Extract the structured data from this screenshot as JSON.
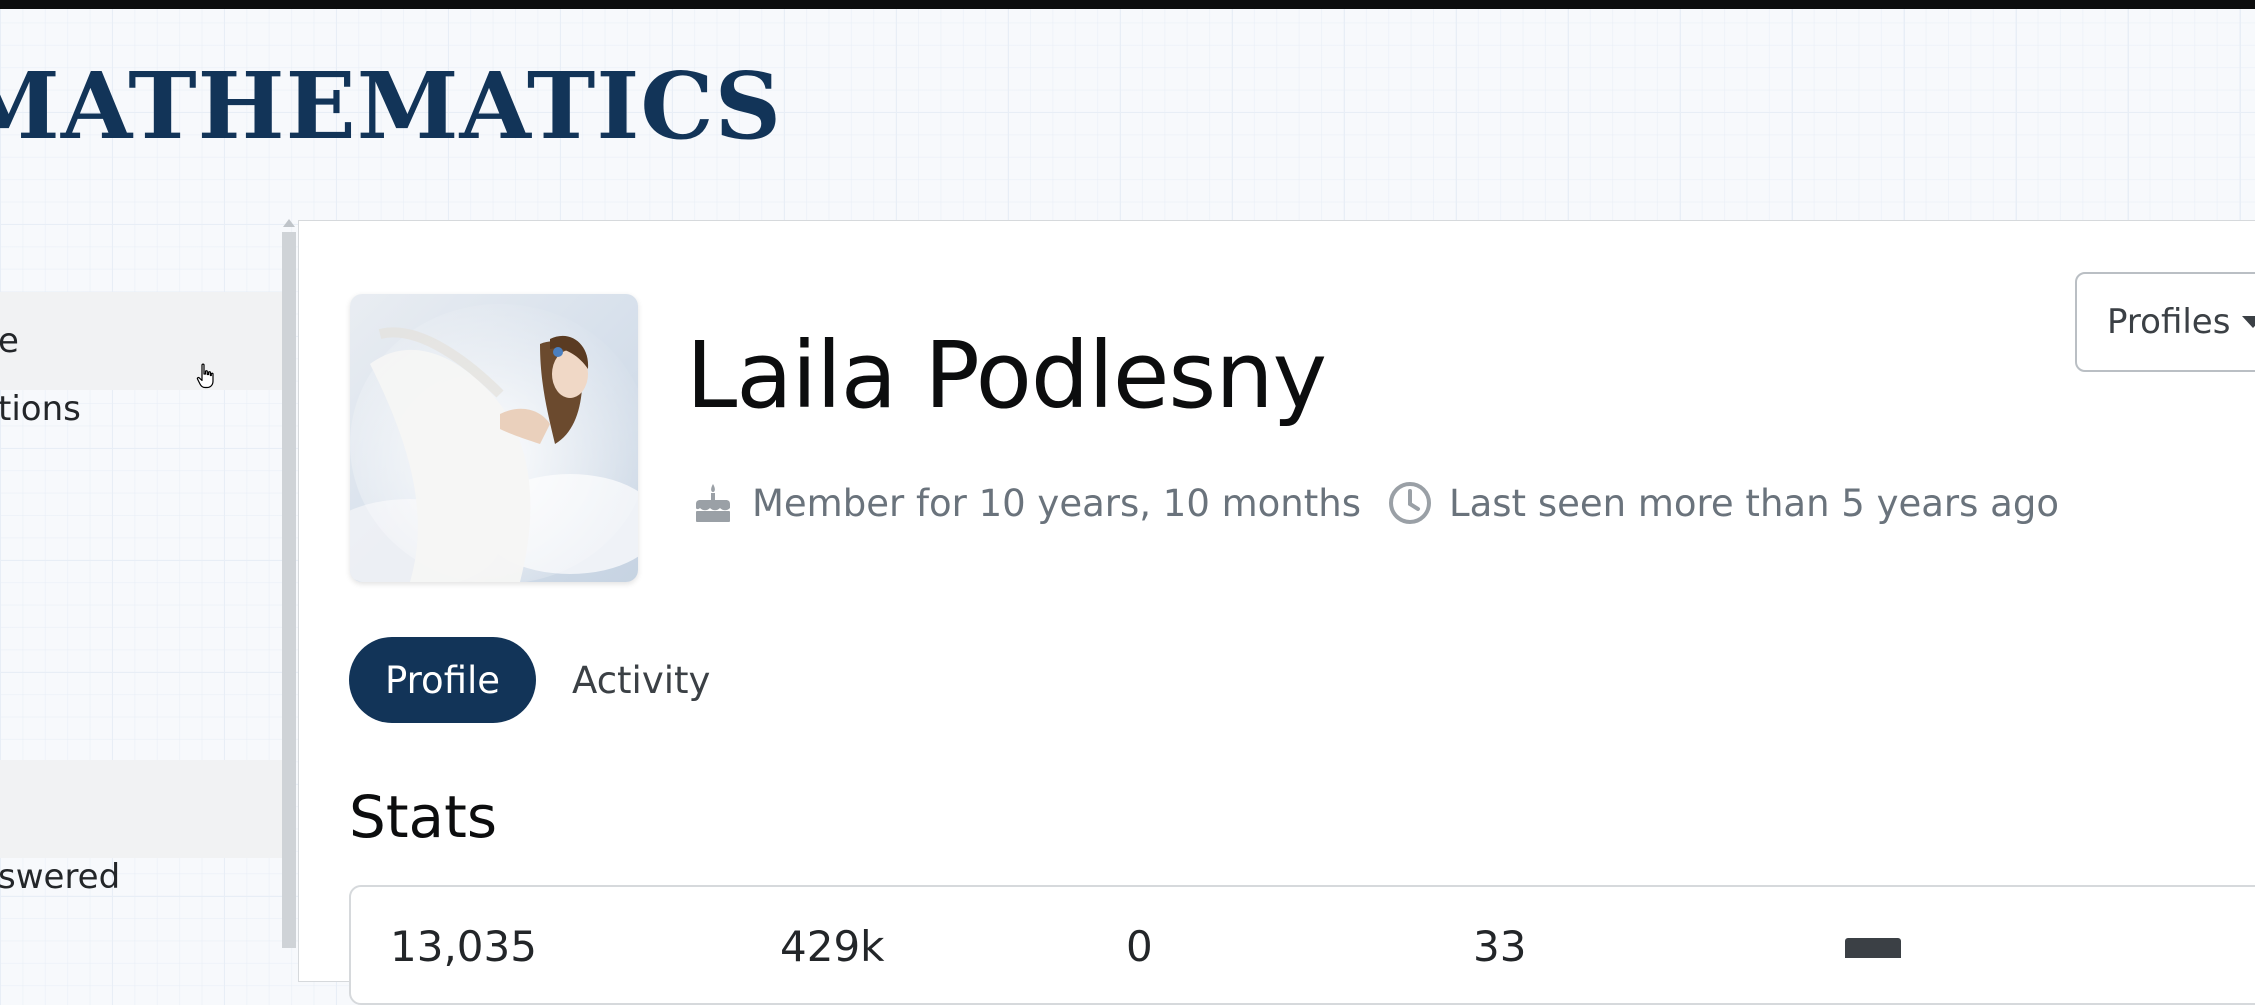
{
  "site": {
    "title": "MATHEMATICS"
  },
  "nav": {
    "items": [
      {
        "label": "e",
        "selected": true
      },
      {
        "label": "tions",
        "selected": false
      },
      {
        "label": "",
        "selected": false
      },
      {
        "label": "",
        "selected": false
      },
      {
        "label": "",
        "selected": true
      },
      {
        "label": "swered",
        "selected": false
      }
    ]
  },
  "user": {
    "name": "Laila Podlesny",
    "member_for": "Member for 10 years, 10 months",
    "last_seen": "Last seen more than 5 years ago"
  },
  "profiles_button": {
    "label": "Profiles"
  },
  "tabs": [
    {
      "label": "Profile",
      "active": true
    },
    {
      "label": "Activity",
      "active": false
    }
  ],
  "stats": {
    "title": "Stats",
    "values": [
      "13,035",
      "429k",
      "0",
      "33"
    ]
  },
  "colors": {
    "brand": "#123458",
    "text": "#0c0d0e",
    "muted": "#6a737c"
  },
  "icons": {
    "member": "cake-icon",
    "last_seen": "clock-icon"
  }
}
